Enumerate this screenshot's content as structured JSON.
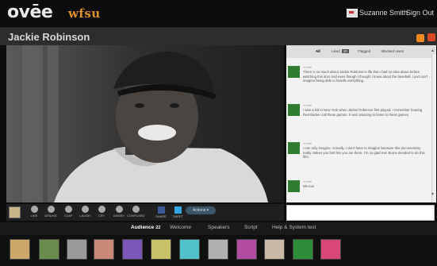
{
  "header": {
    "logo": "ovēe",
    "partner": "wfsu",
    "user_name": "Suzanne Smith",
    "sign_out": "Sign Out"
  },
  "title": "Jackie Robinson",
  "video": {
    "subject": "Black-and-white portrait photo of a smiling man in a baseball cap",
    "controls": [
      {
        "label": "LIKE",
        "icon": "heart-icon"
      },
      {
        "label": "DISLIKE",
        "icon": "thumbs-down-icon"
      },
      {
        "label": "CLAP",
        "icon": "clap-icon"
      },
      {
        "label": "LAUGH",
        "icon": "laugh-icon"
      },
      {
        "label": "CRY",
        "icon": "cry-icon"
      },
      {
        "label": "ANGRY",
        "icon": "angry-icon"
      },
      {
        "label": "CONFUSED",
        "icon": "confused-icon"
      },
      {
        "label": "SHARE",
        "icon": "facebook-icon"
      },
      {
        "label": "TWEET",
        "icon": "twitter-icon"
      }
    ],
    "actions": "Actions ▾"
  },
  "tabs": [
    "All",
    "Liked",
    "Flagged",
    "Blocked users"
  ],
  "liked_count": "10",
  "comments": [
    {
      "author": "Yvette",
      "text": "There is so much about Jackie Robinson's life that I had no idea about before watching this doc! And even though I thought I knew about the baseball. I just can't imagine being able to handle everything."
    },
    {
      "author": "Yvette",
      "text": "I was a kid in New York when Jackie Robinson first played. I remember hearing Red Barber call these games. It was amazing to listen to these games."
    },
    {
      "author": "Yvette",
      "text": "I can only imagine. Actually, I don't have to imagine because this documentary really makes you feel like you are there. I'm so glad Ken Burns decided to do this film."
    },
    {
      "author": "Yvette",
      "text": "Me too!"
    }
  ],
  "bottom_tabs": [
    {
      "label": "Audience",
      "count": "22"
    },
    {
      "label": "Welcome"
    },
    {
      "label": "Speakers"
    },
    {
      "label": "Script"
    },
    {
      "label": "Help & System test"
    }
  ],
  "colors": {
    "accent_orange": "#ef8a24",
    "partner_orange": "#e0922a",
    "facebook": "#3b5998",
    "twitter": "#34a6df"
  }
}
